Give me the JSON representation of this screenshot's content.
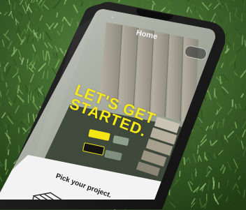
{
  "header": {
    "title": "Home"
  },
  "hero": {
    "headline_line1": "LET'S GET",
    "headline_line2": "STARTED."
  },
  "section": {
    "heading": "Pick your project."
  },
  "colors": {
    "accent_yellow": "#f4e515",
    "grass_dark": "#1e3a14",
    "grass_light": "#6a9a4a",
    "phone_frame": "#1b1b1b",
    "screen_white": "#f3f3f3"
  },
  "icons": {
    "menu": "menu-icon",
    "project": "deck-icon"
  }
}
